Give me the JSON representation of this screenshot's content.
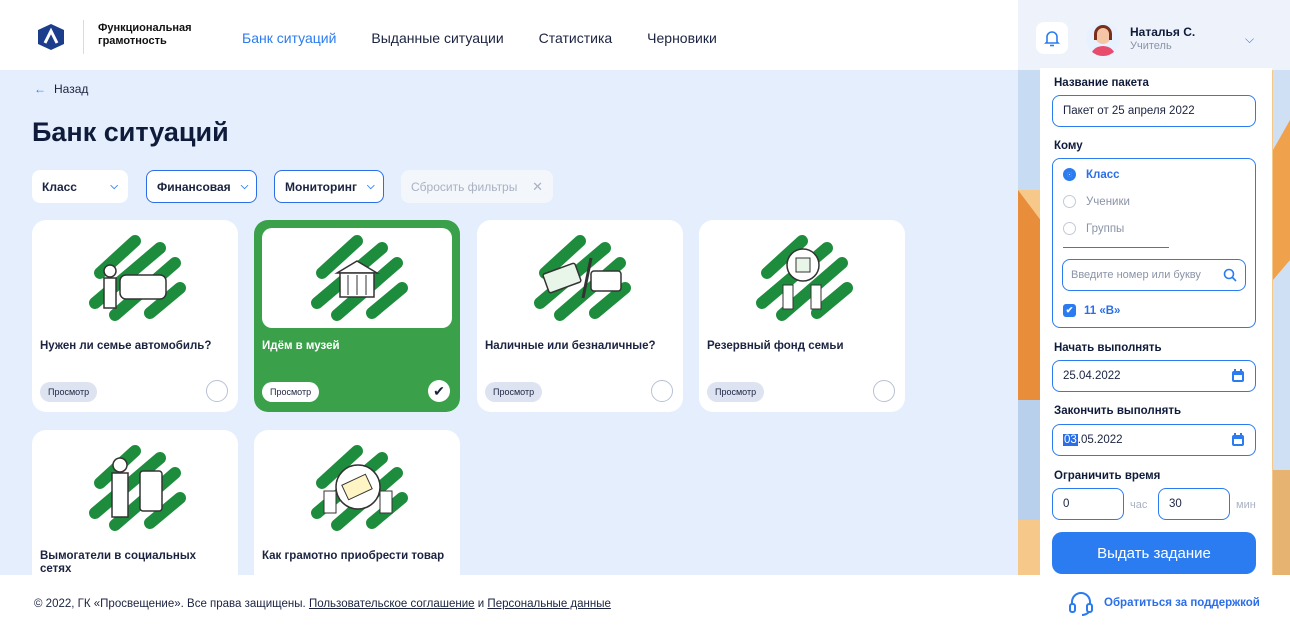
{
  "logo": {
    "line1": "Функциональная",
    "line2": "грамотность"
  },
  "nav": [
    {
      "label": "Банк ситуаций",
      "active": true
    },
    {
      "label": "Выданные ситуации",
      "active": false
    },
    {
      "label": "Статистика",
      "active": false
    },
    {
      "label": "Черновики",
      "active": false
    }
  ],
  "back": {
    "label": "Назад"
  },
  "page_title": "Банк ситуаций",
  "filters": {
    "class": "Класс",
    "type": "Финансовая",
    "mode": "Мониторинг",
    "reset": "Сбросить фильтры"
  },
  "cards": [
    {
      "title": "Нужен ли семье автомобиль?",
      "view": "Просмотр",
      "selected": false
    },
    {
      "title": "Идём в музей",
      "view": "Просмотр",
      "selected": true
    },
    {
      "title": "Наличные или безналичные?",
      "view": "Просмотр",
      "selected": false
    },
    {
      "title": "Резервный фонд семьи",
      "view": "Просмотр",
      "selected": false
    },
    {
      "title": "Вымогатели в социальных сетях",
      "view": "",
      "selected": false
    },
    {
      "title": "Как грамотно приобрести товар",
      "view": "",
      "selected": false
    }
  ],
  "user": {
    "name": "Наталья С.",
    "role": "Учитель"
  },
  "panel": {
    "package_label": "Название пакета",
    "package_value": "Пакет от 25 апреля 2022",
    "to_label": "Кому",
    "options": [
      "Класс",
      "Ученики",
      "Группы"
    ],
    "search_placeholder": "Введите номер или букву",
    "class_checked": "11 «В»",
    "start_label": "Начать выполнять",
    "start_value": "25.04.2022",
    "end_label": "Закончить выполнять",
    "end_value_sel": "03",
    "end_value_rest": ".05.2022",
    "limit_label": "Ограничить время",
    "hours": "0",
    "hours_unit": "час",
    "minutes": "30",
    "minutes_unit": "мин",
    "submit": "Выдать задание"
  },
  "footer": {
    "copyright": "© 2022, ГК «Просвещение». Все права защищены.",
    "agreement": "Пользовательское соглашение",
    "and": "и",
    "personal": "Персональные данные",
    "support": "Обратиться за поддержкой"
  },
  "colors": {
    "accent": "#2b7cf0",
    "selected_card": "#3aa14a",
    "bg": "#e4eefc"
  }
}
